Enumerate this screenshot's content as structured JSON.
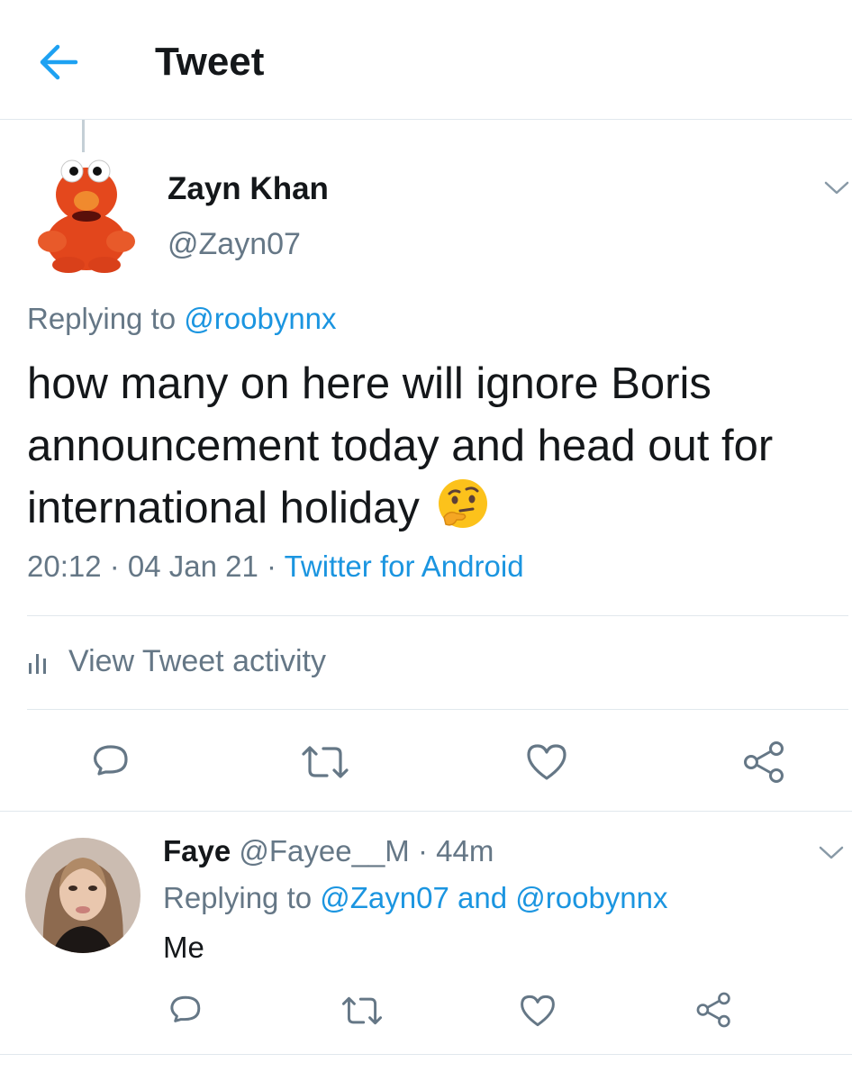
{
  "header": {
    "title": "Tweet",
    "back_icon": "arrow-left-icon",
    "accent": "#1da1f2"
  },
  "main_tweet": {
    "author_name": "Zayn Khan",
    "author_handle": "@Zayn07",
    "replying_prefix": "Replying to ",
    "replying_to": "@roobynnx",
    "text": "how many on here will ignore Boris announcement today and head out for international holiday",
    "emoji": "thinking-face",
    "timestamp": "20:12 · 04 Jan 21 · ",
    "source": "Twitter for Android",
    "activity_label": "View Tweet activity",
    "actions": [
      "reply-icon",
      "retweet-icon",
      "like-icon",
      "share-icon"
    ]
  },
  "reply": {
    "author_name": "Faye",
    "author_handle": " @Fayee__M · 44m",
    "replying_prefix": "Replying to ",
    "replying_to_1": "@Zayn07",
    "replying_and": " and ",
    "replying_to_2": "@roobynnx",
    "text": "Me",
    "actions": [
      "reply-icon",
      "retweet-icon",
      "like-icon",
      "share-icon"
    ]
  },
  "colors": {
    "link": "#1b95e0",
    "secondary_text": "#657786",
    "divider": "#e1e8ed",
    "icon": "#657786"
  }
}
